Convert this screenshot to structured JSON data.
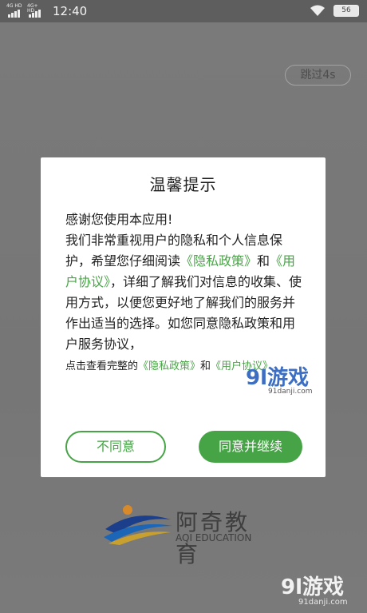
{
  "status_bar": {
    "signal_tags": [
      "4G HD",
      "4G+ HD"
    ],
    "time": "12:40",
    "battery": "56"
  },
  "splash": {
    "skip_label": "跳过4s",
    "logo_cn": "阿奇教育",
    "logo_en": "AQI EDUCATION"
  },
  "dialog": {
    "title": "温馨提示",
    "line1": "感谢您使用本应用!",
    "para_part1": "我们非常重视用户的隐私和个人信息保护，希望您仔细阅读",
    "link_privacy_inline": "《隐私政策》",
    "para_and": "和",
    "link_user_inline": "《用户协议》",
    "para_part2": "，详细了解我们对信息的收集、使用方式，以便您更好地了解我们的服务并作出适当的选择。如您同意隐私政策和用户服务协议，",
    "small_prefix": "点击查看完整的",
    "small_link_privacy": "《隐私政策》",
    "small_and": "和",
    "small_link_user": "《用户协议》",
    "disagree_label": "不同意",
    "agree_label": "同意并继续"
  },
  "watermarks": {
    "mid_main": "9l游戏",
    "mid_site": "91danji.com",
    "bottom_main": "9l游戏",
    "bottom_site": "91danji.com"
  },
  "colors": {
    "accent_green": "#46a346",
    "overlay_gray": "#7a7a7a"
  }
}
